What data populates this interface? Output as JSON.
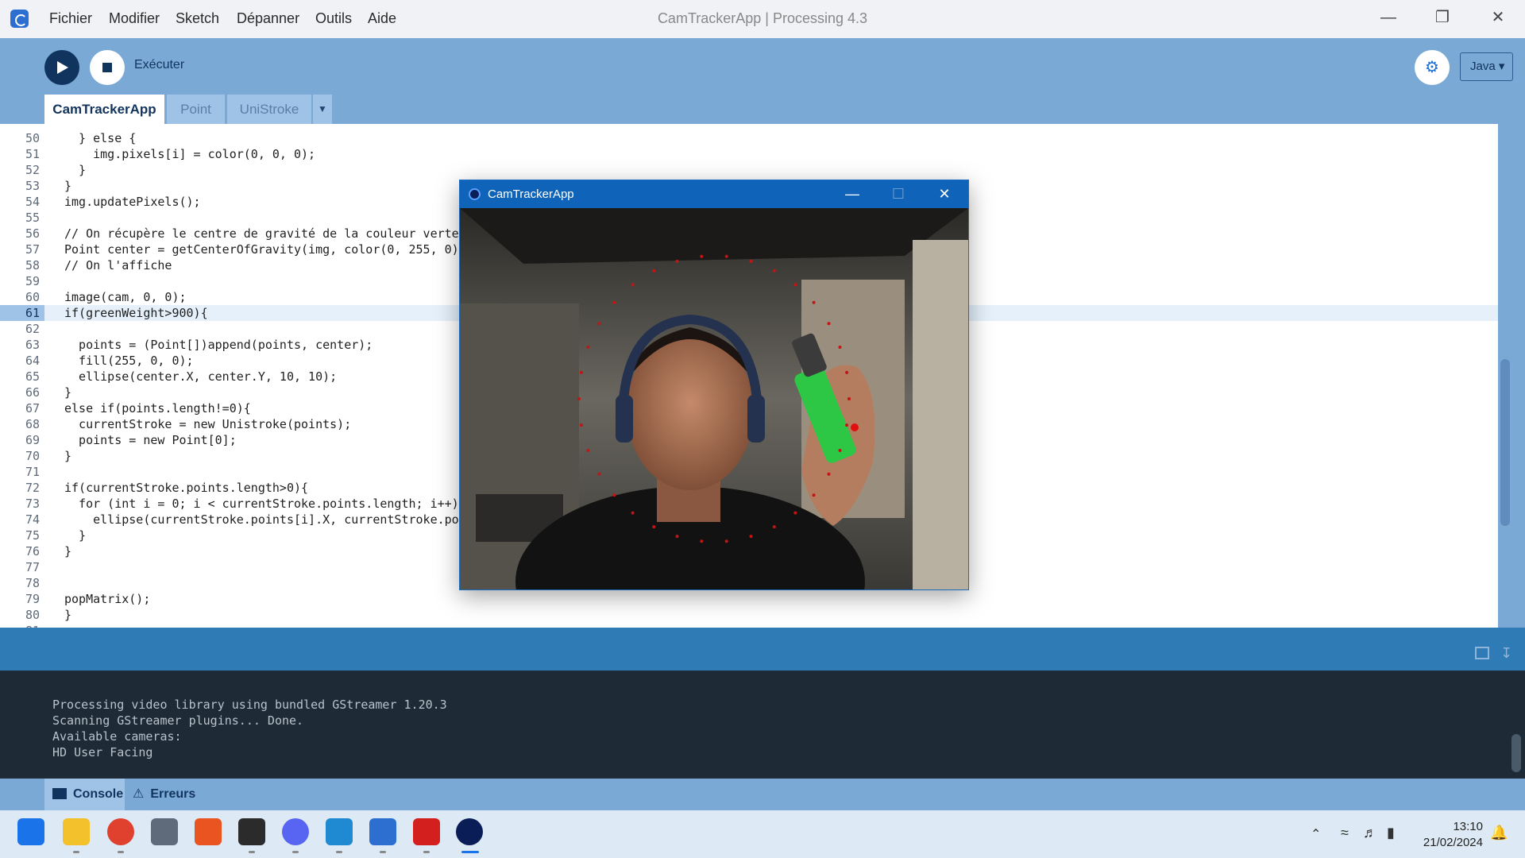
{
  "window": {
    "title": "CamTrackerApp | Processing 4.3",
    "menu": [
      "Fichier",
      "Modifier",
      "Sketch",
      "Dépanner",
      "Outils",
      "Aide"
    ]
  },
  "toolbar": {
    "run_label": "Exécuter",
    "mode": "Java ▾"
  },
  "tabs": [
    "CamTrackerApp",
    "Point",
    "UniStroke"
  ],
  "editor": {
    "current_line": 61,
    "lines": [
      {
        "n": "50",
        "code": "  } else {"
      },
      {
        "n": "51",
        "code": "    img.pixels[i] = color(0, 0, 0);"
      },
      {
        "n": "52",
        "code": "  }"
      },
      {
        "n": "53",
        "code": "}"
      },
      {
        "n": "54",
        "code": "img.updatePixels();"
      },
      {
        "n": "55",
        "code": ""
      },
      {
        "n": "56",
        "code": "// On récupère le centre de gravité de la couleur verte"
      },
      {
        "n": "57",
        "code": "Point center = getCenterOfGravity(img, color(0, 255, 0));"
      },
      {
        "n": "58",
        "code": "// On l'affiche"
      },
      {
        "n": "59",
        "code": ""
      },
      {
        "n": "60",
        "code": "image(cam, 0, 0);"
      },
      {
        "n": "61",
        "code": "if(greenWeight>900){"
      },
      {
        "n": "62",
        "code": ""
      },
      {
        "n": "63",
        "code": "  points = (Point[])append(points, center);"
      },
      {
        "n": "64",
        "code": "  fill(255, 0, 0);"
      },
      {
        "n": "65",
        "code": "  ellipse(center.X, center.Y, 10, 10);"
      },
      {
        "n": "66",
        "code": "}"
      },
      {
        "n": "67",
        "code": "else if(points.length!=0){"
      },
      {
        "n": "68",
        "code": "  currentStroke = new Unistroke(points);"
      },
      {
        "n": "69",
        "code": "  points = new Point[0];"
      },
      {
        "n": "70",
        "code": "}"
      },
      {
        "n": "71",
        "code": ""
      },
      {
        "n": "72",
        "code": "if(currentStroke.points.length>0){"
      },
      {
        "n": "73",
        "code": "  for (int i = 0; i < currentStroke.points.length; i++) {"
      },
      {
        "n": "74",
        "code": "    ellipse(currentStroke.points[i].X, currentStroke.poin"
      },
      {
        "n": "75",
        "code": "  }"
      },
      {
        "n": "76",
        "code": "}"
      },
      {
        "n": "77",
        "code": ""
      },
      {
        "n": "78",
        "code": ""
      },
      {
        "n": "79",
        "code": "popMatrix();"
      },
      {
        "n": "80",
        "code": "}"
      },
      {
        "n": "81",
        "code": ""
      }
    ]
  },
  "console": {
    "lines": [
      "Processing video library using bundled GStreamer 1.20.3",
      "Scanning GStreamer plugins... Done.",
      "Available cameras:",
      "HD User Facing"
    ],
    "tabs": [
      "Console",
      "Erreurs"
    ]
  },
  "sketch_window": {
    "title": "CamTrackerApp"
  },
  "taskbar": {
    "time": "13:10",
    "date": "21/02/2024",
    "apps": [
      "start-icon",
      "file-explorer-icon",
      "chrome-icon",
      "snipping-tool-icon",
      "ubuntu-icon",
      "terminal-icon",
      "discord-icon",
      "vscode-icon",
      "processing-icon",
      "acrobat-icon",
      "camtracker-icon"
    ]
  },
  "colors": {
    "toolbar": "#7aa9d6",
    "accent": "#11345e",
    "console_bg": "#1e2a36",
    "sketch_title": "#0f63b8"
  }
}
